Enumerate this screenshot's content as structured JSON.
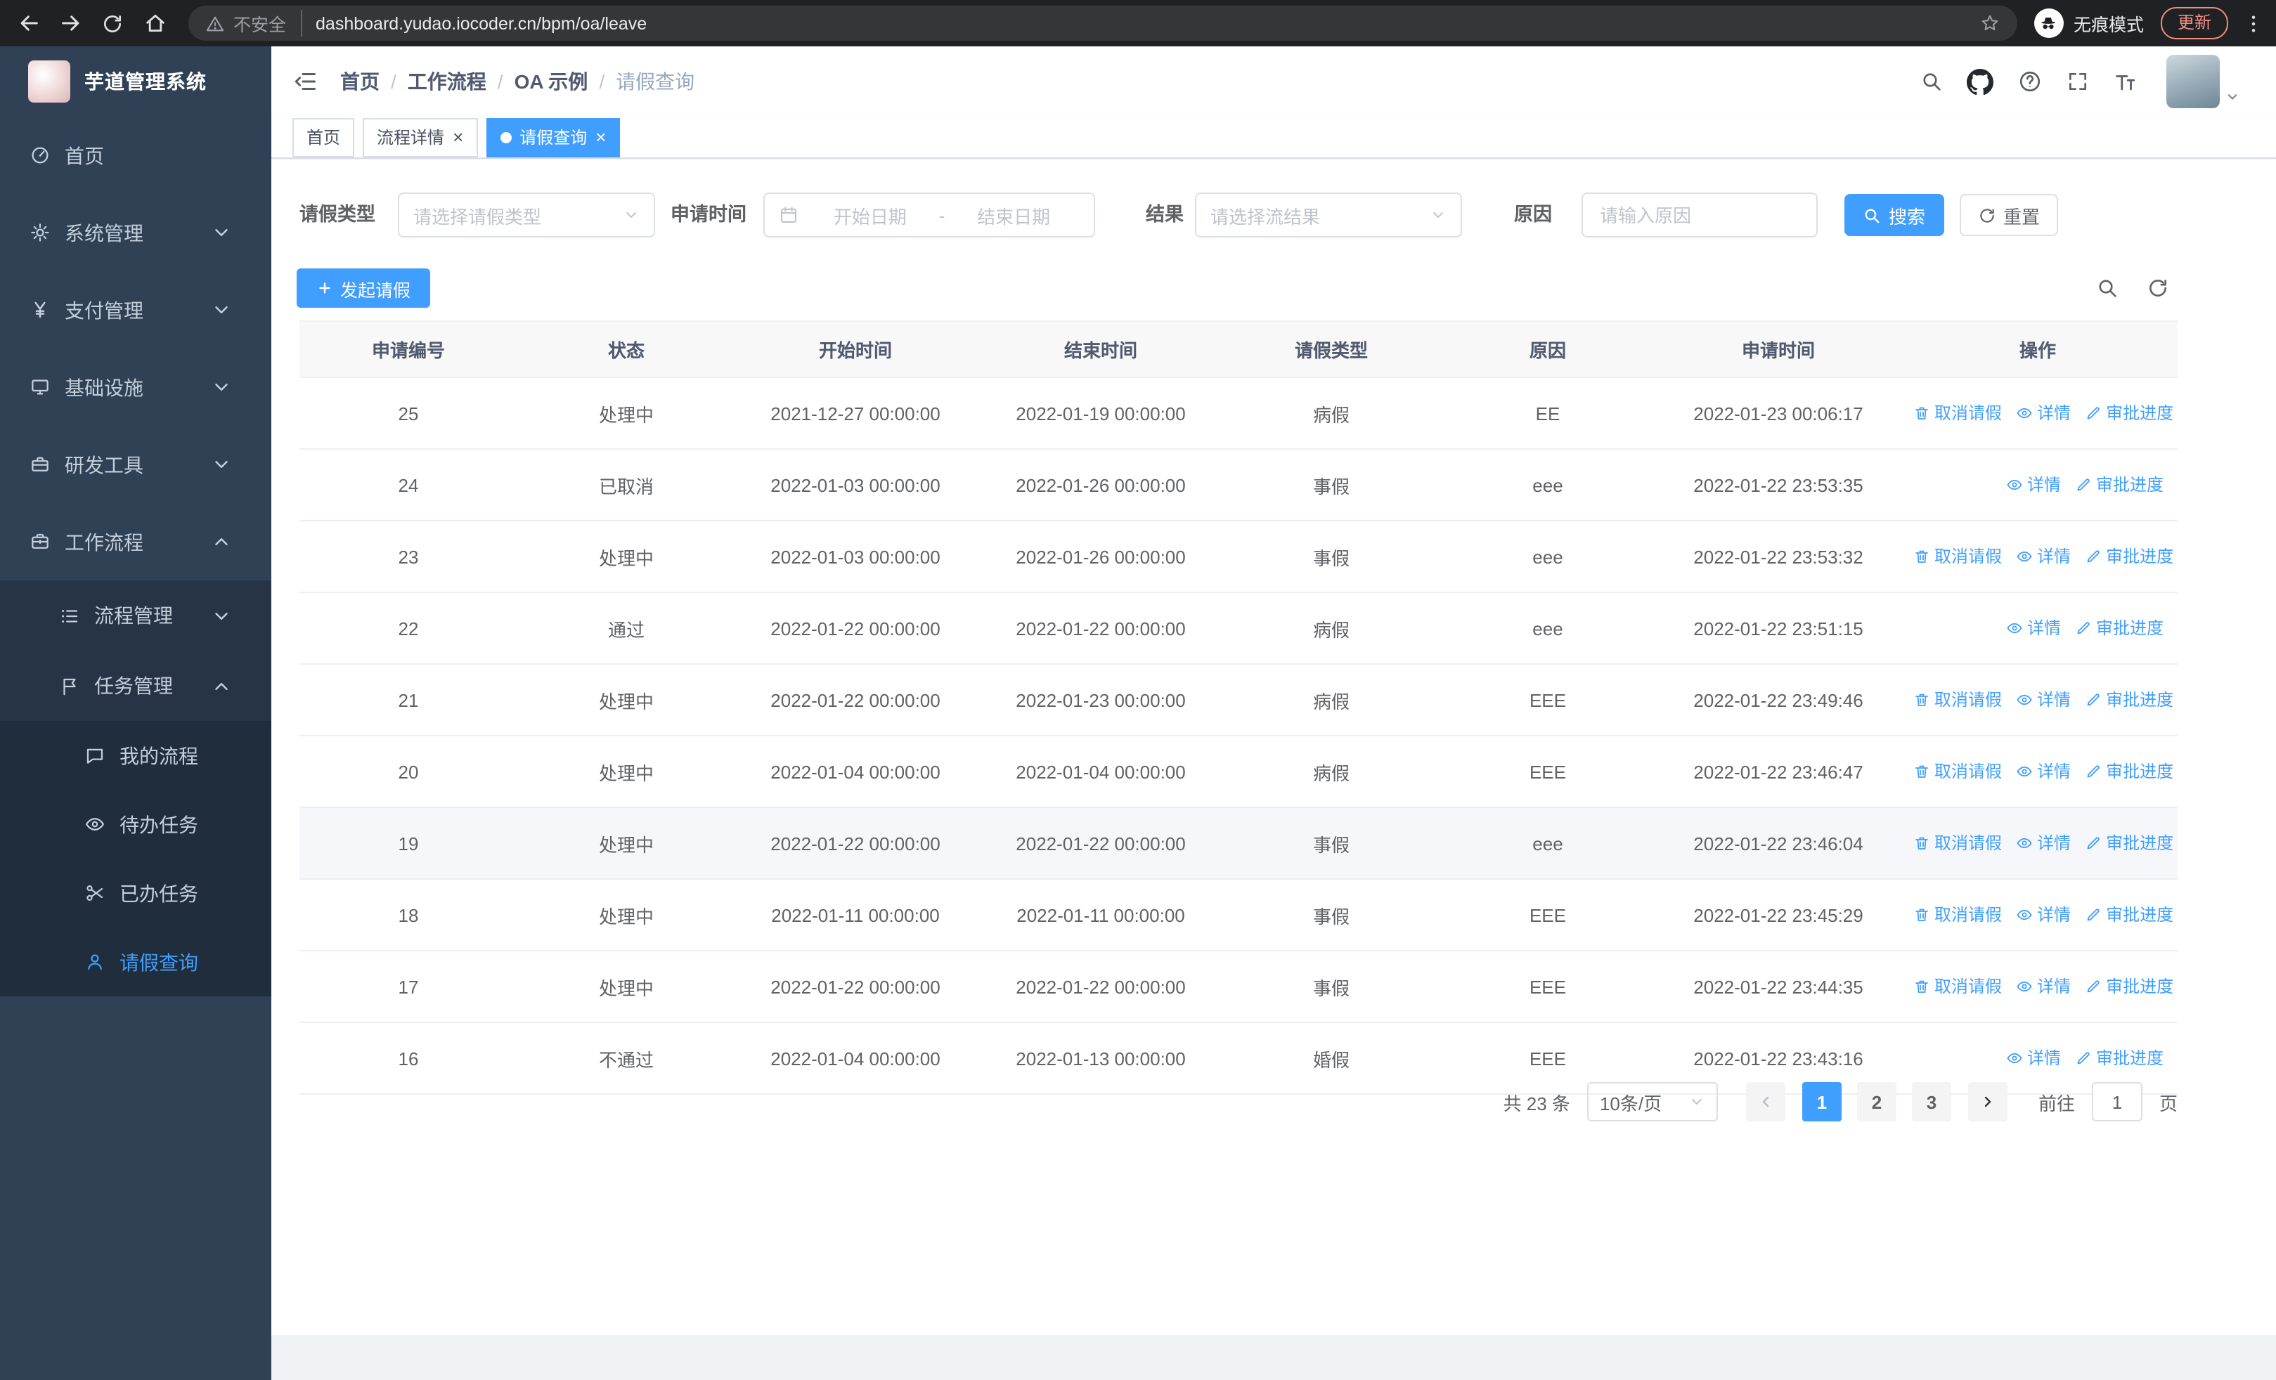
{
  "browser": {
    "security_chip": "不安全",
    "url": "dashboard.yudao.iocoder.cn/bpm/oa/leave",
    "incognito_label": "无痕模式",
    "update_label": "更新"
  },
  "sidebar": {
    "app_title": "芋道管理系统",
    "menu": [
      {
        "id": "home",
        "label": "首页",
        "icon": "dashboard",
        "level": 1
      },
      {
        "id": "system-management",
        "label": "系统管理",
        "icon": "gear",
        "level": 1,
        "chevron": "down"
      },
      {
        "id": "payment-management",
        "label": "支付管理",
        "icon": "yen",
        "level": 1,
        "chevron": "down"
      },
      {
        "id": "infrastructure",
        "label": "基础设施",
        "icon": "infra",
        "level": 1,
        "chevron": "down"
      },
      {
        "id": "dev-tools",
        "label": "研发工具",
        "icon": "tools",
        "level": 1,
        "chevron": "down"
      },
      {
        "id": "workflow",
        "label": "工作流程",
        "icon": "workflow",
        "level": 1,
        "chevron": "up"
      },
      {
        "id": "process-management",
        "label": "流程管理",
        "icon": "process",
        "level": 2,
        "chevron": "down"
      },
      {
        "id": "task-management",
        "label": "任务管理",
        "icon": "task",
        "level": 2,
        "chevron": "up"
      },
      {
        "id": "my-process",
        "label": "我的流程",
        "icon": "chat",
        "level": 3
      },
      {
        "id": "todo-tasks",
        "label": "待办任务",
        "icon": "eye",
        "level": 3
      },
      {
        "id": "done-tasks",
        "label": "已办任务",
        "icon": "scissors",
        "level": 3
      },
      {
        "id": "leave-query",
        "label": "请假查询",
        "icon": "user",
        "level": 3,
        "active": true
      }
    ]
  },
  "header": {
    "breadcrumb": [
      "首页",
      "工作流程",
      "OA 示例",
      "请假查询"
    ]
  },
  "tabs": [
    {
      "label": "首页",
      "closable": false,
      "active": false
    },
    {
      "label": "流程详情",
      "closable": true,
      "active": false
    },
    {
      "label": "请假查询",
      "closable": true,
      "active": true
    }
  ],
  "filters": {
    "leave_type_label": "请假类型",
    "leave_type_placeholder": "请选择请假类型",
    "apply_time_label": "申请时间",
    "start_date_placeholder": "开始日期",
    "range_separator": "-",
    "end_date_placeholder": "结束日期",
    "result_label": "结果",
    "result_placeholder": "请选择流结果",
    "reason_label": "原因",
    "reason_placeholder": "请输入原因",
    "search_button": "搜索",
    "reset_button": "重置"
  },
  "toolbar": {
    "create_button": "发起请假"
  },
  "table": {
    "columns": [
      "申请编号",
      "状态",
      "开始时间",
      "结束时间",
      "请假类型",
      "原因",
      "申请时间",
      "操作"
    ],
    "action_labels": {
      "cancel": "取消请假",
      "detail": "详情",
      "progress": "审批进度"
    },
    "rows": [
      {
        "id": "25",
        "status": "处理中",
        "start": "2021-12-27 00:00:00",
        "end": "2022-01-19 00:00:00",
        "type": "病假",
        "reason": "EE",
        "applied": "2022-01-23 00:06:17",
        "actions": [
          "cancel",
          "detail",
          "progress"
        ]
      },
      {
        "id": "24",
        "status": "已取消",
        "start": "2022-01-03 00:00:00",
        "end": "2022-01-26 00:00:00",
        "type": "事假",
        "reason": "eee",
        "applied": "2022-01-22 23:53:35",
        "actions": [
          "detail",
          "progress"
        ]
      },
      {
        "id": "23",
        "status": "处理中",
        "start": "2022-01-03 00:00:00",
        "end": "2022-01-26 00:00:00",
        "type": "事假",
        "reason": "eee",
        "applied": "2022-01-22 23:53:32",
        "actions": [
          "cancel",
          "detail",
          "progress"
        ]
      },
      {
        "id": "22",
        "status": "通过",
        "start": "2022-01-22 00:00:00",
        "end": "2022-01-22 00:00:00",
        "type": "病假",
        "reason": "eee",
        "applied": "2022-01-22 23:51:15",
        "actions": [
          "detail",
          "progress"
        ]
      },
      {
        "id": "21",
        "status": "处理中",
        "start": "2022-01-22 00:00:00",
        "end": "2022-01-23 00:00:00",
        "type": "病假",
        "reason": "EEE",
        "applied": "2022-01-22 23:49:46",
        "actions": [
          "cancel",
          "detail",
          "progress"
        ]
      },
      {
        "id": "20",
        "status": "处理中",
        "start": "2022-01-04 00:00:00",
        "end": "2022-01-04 00:00:00",
        "type": "病假",
        "reason": "EEE",
        "applied": "2022-01-22 23:46:47",
        "actions": [
          "cancel",
          "detail",
          "progress"
        ]
      },
      {
        "id": "19",
        "status": "处理中",
        "start": "2022-01-22 00:00:00",
        "end": "2022-01-22 00:00:00",
        "type": "事假",
        "reason": "eee",
        "applied": "2022-01-22 23:46:04",
        "actions": [
          "cancel",
          "detail",
          "progress"
        ],
        "highlighted": true
      },
      {
        "id": "18",
        "status": "处理中",
        "start": "2022-01-11 00:00:00",
        "end": "2022-01-11 00:00:00",
        "type": "事假",
        "reason": "EEE",
        "applied": "2022-01-22 23:45:29",
        "actions": [
          "cancel",
          "detail",
          "progress"
        ]
      },
      {
        "id": "17",
        "status": "处理中",
        "start": "2022-01-22 00:00:00",
        "end": "2022-01-22 00:00:00",
        "type": "事假",
        "reason": "EEE",
        "applied": "2022-01-22 23:44:35",
        "actions": [
          "cancel",
          "detail",
          "progress"
        ]
      },
      {
        "id": "16",
        "status": "不通过",
        "start": "2022-01-04 00:00:00",
        "end": "2022-01-13 00:00:00",
        "type": "婚假",
        "reason": "EEE",
        "applied": "2022-01-22 23:43:16",
        "actions": [
          "detail",
          "progress"
        ]
      }
    ]
  },
  "pagination": {
    "total": "共 23 条",
    "page_size": "10条/页",
    "pages": [
      {
        "label": "1",
        "active": true
      },
      {
        "label": "2",
        "active": false
      },
      {
        "label": "3",
        "active": false
      }
    ],
    "goto_label": "前往",
    "goto_value": "1",
    "page_label": "页"
  },
  "colors": {
    "accent": "#409eff",
    "update_badge": "#f28b82",
    "sidebar_bg": "#304156"
  }
}
